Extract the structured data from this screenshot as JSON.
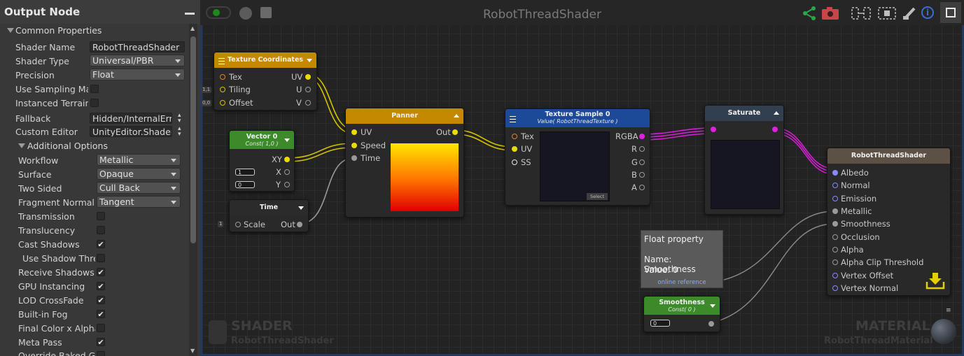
{
  "panel": {
    "title": "Output Node",
    "common_section": "Common Properties",
    "common_props": [
      {
        "label": "Shader Name",
        "value": "RobotThreadShader"
      },
      {
        "label": "Shader Type",
        "value": "Universal/PBR"
      },
      {
        "label": "Precision",
        "value": "Float"
      },
      {
        "label": "Use Sampling Macros"
      },
      {
        "label": "Instanced Terrain"
      },
      {
        "label": "Fallback",
        "value": "Hidden/InternalErrorShader"
      },
      {
        "label": "Custom Editor",
        "value": "UnityEditor.ShaderGraph"
      }
    ],
    "additional_section": "Additional Options",
    "additional_props": [
      {
        "label": "Workflow",
        "value": "Metallic"
      },
      {
        "label": "Surface",
        "value": "Opaque"
      },
      {
        "label": "Two Sided",
        "value": "Cull Back"
      },
      {
        "label": "Fragment Normal Space",
        "value": "Tangent"
      },
      {
        "label": "Transmission",
        "checked": ""
      },
      {
        "label": "Translucency",
        "checked": ""
      },
      {
        "label": "Cast Shadows",
        "checked": "✔"
      },
      {
        "label": "Use Shadow Threshold",
        "checked": ""
      },
      {
        "label": "Receive Shadows",
        "checked": "✔"
      },
      {
        "label": "GPU Instancing",
        "checked": "✔"
      },
      {
        "label": "LOD CrossFade",
        "checked": "✔"
      },
      {
        "label": "Built-in Fog",
        "checked": "✔"
      },
      {
        "label": "Final Color x Alpha",
        "checked": ""
      },
      {
        "label": "Meta Pass",
        "checked": "✔"
      },
      {
        "label": "Override Baked GI",
        "checked": ""
      }
    ]
  },
  "canvas": {
    "title": "RobotThreadShader",
    "watermark_left": {
      "big": "SHADER",
      "small": "RobotThreadShader"
    },
    "watermark_right": {
      "big": "MATERIAL",
      "small": "RobotThreadMaterial"
    }
  },
  "nodes": {
    "texcoords": {
      "title": "Texture Coordinates",
      "inputs": [
        "Tex",
        "Tiling",
        "Offset"
      ],
      "outputs": [
        "UV",
        "U",
        "V"
      ],
      "tags": [
        "1,1",
        "0,0"
      ]
    },
    "vector0": {
      "title": "Vector 0",
      "subtitle": "Const( 1,0 )",
      "output": "XY",
      "fields": [
        {
          "value": "1",
          "label": "X"
        },
        {
          "value": "0",
          "label": "Y"
        }
      ]
    },
    "time": {
      "title": "Time",
      "input": "Scale",
      "output": "Out",
      "tag": "1"
    },
    "panner": {
      "title": "Panner",
      "inputs": [
        "UV",
        "Speed",
        "Time"
      ],
      "output": "Out"
    },
    "texsample": {
      "title": "Texture Sample 0",
      "subtitle": "Value( RobotThreadTexture )",
      "inputs": [
        "Tex",
        "UV",
        "SS"
      ],
      "outputs": [
        "RGBA",
        "R",
        "G",
        "B",
        "A"
      ],
      "select": "Select"
    },
    "saturate": {
      "title": "Saturate"
    },
    "output": {
      "title": "RobotThreadShader",
      "inputs": [
        "Albedo",
        "Normal",
        "Emission",
        "Metallic",
        "Smoothness",
        "Occlusion",
        "Alpha",
        "Alpha Clip Threshold",
        "Vertex Offset",
        "Vertex Normal"
      ]
    },
    "smoothness": {
      "title": "Smoothness",
      "subtitle": "Const( 0 )",
      "value": "0"
    }
  },
  "tooltip": {
    "title": "Float property",
    "name": "Name: Smoothness",
    "value": "Value: 0",
    "link": "online reference"
  },
  "colors": {
    "accent": "#e6cf00",
    "magenta": "#e020e0",
    "output_port": "#8888ff"
  }
}
